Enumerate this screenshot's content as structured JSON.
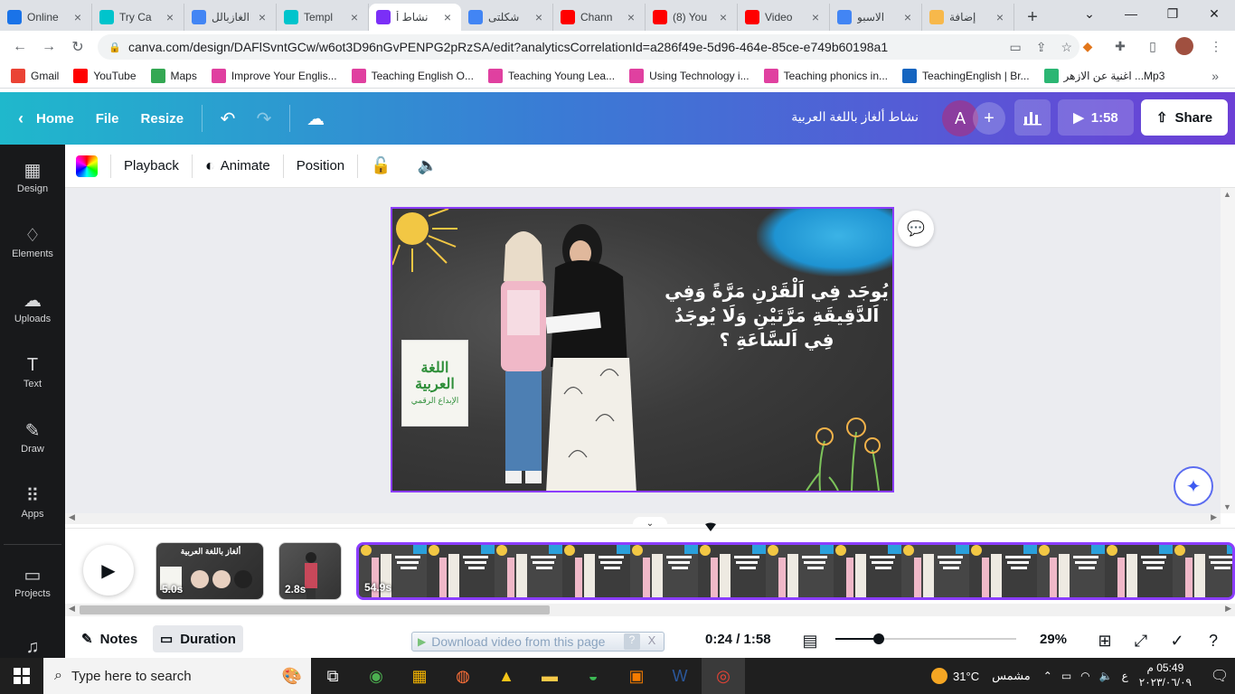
{
  "browser": {
    "tabs": [
      {
        "label": "Online",
        "color": "#1a73e8",
        "icon": "globe-icon"
      },
      {
        "label": "Try Ca",
        "color": "#00c4cc",
        "icon": "canva-icon"
      },
      {
        "label": "الغازبالل",
        "color": "#4285f4",
        "icon": "google-icon"
      },
      {
        "label": "Templ",
        "color": "#00c4cc",
        "icon": "canva-icon"
      },
      {
        "label": "نشاط أ",
        "color": "#7b2ff7",
        "icon": "video-icon",
        "active": true
      },
      {
        "label": "شكلتى",
        "color": "#4285f4",
        "icon": "google-icon"
      },
      {
        "label": "Chann",
        "color": "#ff0000",
        "icon": "youtube-icon"
      },
      {
        "label": "(8) You",
        "color": "#ff0000",
        "icon": "youtube-icon"
      },
      {
        "label": "Video",
        "color": "#ff0000",
        "icon": "youtube-icon"
      },
      {
        "label": "الاسبو",
        "color": "#4285f4",
        "icon": "google-icon"
      },
      {
        "label": "إضافة",
        "color": "#f7b84b",
        "icon": "extension-icon"
      }
    ],
    "new_tab": "+",
    "url": "canva.com/design/DAFlSvntGCw/w6ot3D96nGvPENPG2pRzSA/edit?analyticsCorrelationId=a286f49e-5d96-464e-85ce-e749b60198a1",
    "bookmarks": [
      {
        "label": "Gmail",
        "color": "#ea4335",
        "icon": "gmail-icon"
      },
      {
        "label": "YouTube",
        "color": "#ff0000",
        "icon": "youtube-icon"
      },
      {
        "label": "Maps",
        "color": "#34a853",
        "icon": "maps-icon"
      },
      {
        "label": "Improve Your Englis...",
        "color": "#e040a0",
        "icon": "bookmark-site-icon"
      },
      {
        "label": "Teaching English O...",
        "color": "#e040a0",
        "icon": "bookmark-site-icon"
      },
      {
        "label": "Teaching Young Lea...",
        "color": "#e040a0",
        "icon": "bookmark-site-icon"
      },
      {
        "label": "Using Technology i...",
        "color": "#e040a0",
        "icon": "bookmark-site-icon"
      },
      {
        "label": "Teaching phonics in...",
        "color": "#e040a0",
        "icon": "bookmark-site-icon"
      },
      {
        "label": "TeachingEnglish | Br...",
        "color": "#1565c0",
        "icon": "bookmark-site-icon"
      },
      {
        "label": "اغنية عن الازهر ...Mp3",
        "color": "#2bb673",
        "icon": "bookmark-site-icon"
      }
    ],
    "more_bookmarks": "»"
  },
  "canva": {
    "header": {
      "home": "Home",
      "file": "File",
      "resize": "Resize",
      "title": "نشاط ألغاز باللغة العربية",
      "avatar_letter": "A",
      "duration": "1:58",
      "share": "Share"
    },
    "toolbar": {
      "playback": "Playback",
      "animate": "Animate",
      "position": "Position"
    },
    "sidebar": [
      {
        "label": "Design",
        "icon": "design-icon"
      },
      {
        "label": "Elements",
        "icon": "elements-icon"
      },
      {
        "label": "Uploads",
        "icon": "uploads-icon"
      },
      {
        "label": "Text",
        "icon": "text-icon"
      },
      {
        "label": "Draw",
        "icon": "draw-icon"
      },
      {
        "label": "Apps",
        "icon": "apps-icon"
      },
      {
        "label": "Projects",
        "icon": "projects-icon"
      },
      {
        "label": "",
        "icon": "music-icon"
      }
    ],
    "slide": {
      "riddle_text": "يُوجَد فِي اَلْقَرْنِ مَرَّةً وَفِي اَلدَّقِيقَةِ مَرَّتَيْنِ وَلَا يُوجَدُ فِي اَلسَّاعَةِ ؟",
      "logo_line1": "اللغة",
      "logo_line2": "العربية",
      "logo_sub": "الإبداع الرقمي"
    },
    "timeline": {
      "clips": [
        {
          "duration": "5.0s",
          "caption": "ألغاز باللغة العربية"
        },
        {
          "duration": "2.8s",
          "caption": ""
        },
        {
          "duration": "54.9s",
          "caption": ""
        }
      ]
    },
    "bottom": {
      "notes": "Notes",
      "duration": "Duration",
      "timecode": "0:24 / 1:58",
      "zoom": "29%",
      "zoom_level": 0.24,
      "download_bar": "Download video from this page",
      "download_help": "?",
      "download_close": "X"
    }
  },
  "taskbar": {
    "search_placeholder": "Type here to search",
    "temperature": "31°C",
    "weather": "مشمس",
    "time": "05:49 م",
    "date": "٢٠٢٣/٠٦/٠٩",
    "lang": "ع"
  }
}
